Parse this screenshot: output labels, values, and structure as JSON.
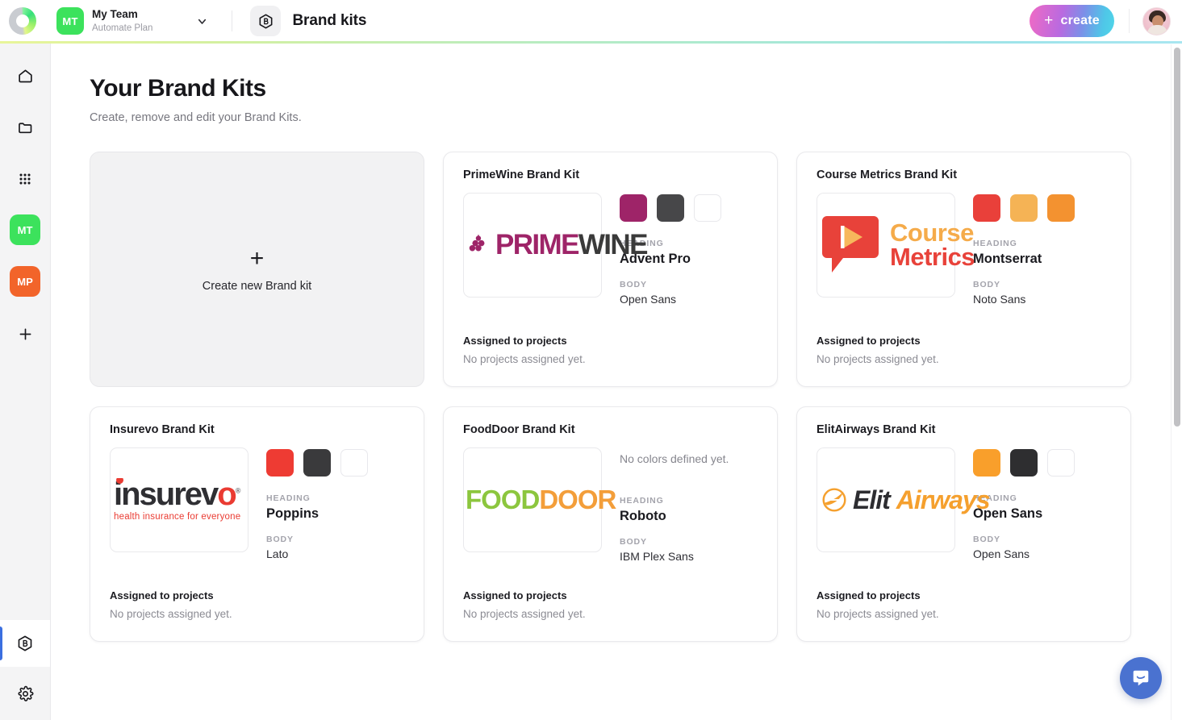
{
  "topbar": {
    "logo_icon": "app-logo-circle-icon",
    "team": {
      "initials": "MT",
      "name": "My Team",
      "plan": "Automate Plan",
      "caret_icon": "chevron-down-icon"
    },
    "page_icon": "brand-kit-hexagon-icon",
    "page_title": "Brand kits",
    "create_button": {
      "label": "create",
      "plus": "+"
    },
    "avatar_alt": "user-avatar"
  },
  "sidebar": {
    "items": [
      {
        "name": "home",
        "icon": "home-icon",
        "type": "icon"
      },
      {
        "name": "folders",
        "icon": "folder-icon",
        "type": "icon"
      },
      {
        "name": "apps",
        "icon": "grid-apps-icon",
        "type": "icon"
      },
      {
        "name": "my-team",
        "initials": "MT",
        "color": "#3ce25c",
        "type": "tile"
      },
      {
        "name": "mp-workspace",
        "initials": "MP",
        "color": "#f2642a",
        "type": "tile"
      },
      {
        "name": "add-workspace",
        "icon": "plus-icon",
        "type": "icon"
      }
    ],
    "bottom": [
      {
        "name": "brand-kits",
        "icon": "brand-kit-hexagon-icon",
        "active": true
      },
      {
        "name": "settings",
        "icon": "gear-icon",
        "active": false
      }
    ]
  },
  "page": {
    "title": "Your Brand Kits",
    "subtitle": "Create, remove and edit your Brand Kits."
  },
  "new_kit_card": {
    "plus": "+",
    "label": "Create new Brand kit"
  },
  "labels": {
    "heading": "HEADING",
    "body": "BODY",
    "assigned_title": "Assigned to projects",
    "assigned_empty": "No projects assigned yet.",
    "no_colors": "No colors defined yet."
  },
  "brand_kits": [
    {
      "title": "PrimeWine Brand Kit",
      "logo": "primewine",
      "logo_text": {
        "part1": "PRIME",
        "part2": "WINE"
      },
      "colors": [
        "#9e2468",
        "#474749",
        "#ffffff"
      ],
      "heading_font": "Advent Pro",
      "body_font": "Open Sans",
      "assigned_title": "Assigned to projects",
      "assigned_empty": "No projects assigned yet."
    },
    {
      "title": "Course Metrics Brand Kit",
      "logo": "course-metrics",
      "logo_text": {
        "part1": "Course",
        "part2": "Metrics"
      },
      "colors": [
        "#e9403a",
        "#f5b355",
        "#f39230"
      ],
      "heading_font": "Montserrat",
      "body_font": "Noto Sans",
      "assigned_title": "Assigned to projects",
      "assigned_empty": "No projects assigned yet."
    },
    {
      "title": "Insurevo Brand Kit",
      "logo": "insurevo",
      "logo_text": {
        "part1": "insurev",
        "part2": "o",
        "tagline": "health insurance for everyone"
      },
      "colors": [
        "#ee3b33",
        "#3a3a3c",
        "#ffffff"
      ],
      "heading_font": "Poppins",
      "body_font": "Lato",
      "assigned_title": "Assigned to projects",
      "assigned_empty": "No projects assigned yet."
    },
    {
      "title": "FoodDoor Brand Kit",
      "logo": "fooddoor",
      "logo_text": {
        "part1": "FOOD",
        "part2": "DOOR"
      },
      "colors": [],
      "no_colors": "No colors defined yet.",
      "heading_font": "Roboto",
      "body_font": "IBM Plex Sans",
      "assigned_title": "Assigned to projects",
      "assigned_empty": "No projects assigned yet."
    },
    {
      "title": "ElitAirways Brand Kit",
      "logo": "elitairways",
      "logo_text": {
        "part1": "Elit",
        "part2": "Airways"
      },
      "colors": [
        "#f99f2b",
        "#2e2e30",
        "#ffffff"
      ],
      "heading_font": "Open Sans",
      "body_font": "Open Sans",
      "assigned_title": "Assigned to projects",
      "assigned_empty": "No projects assigned yet."
    }
  ],
  "chat_widget": {
    "icon": "chat-bubble-smile-icon",
    "color": "#4a72d0"
  }
}
